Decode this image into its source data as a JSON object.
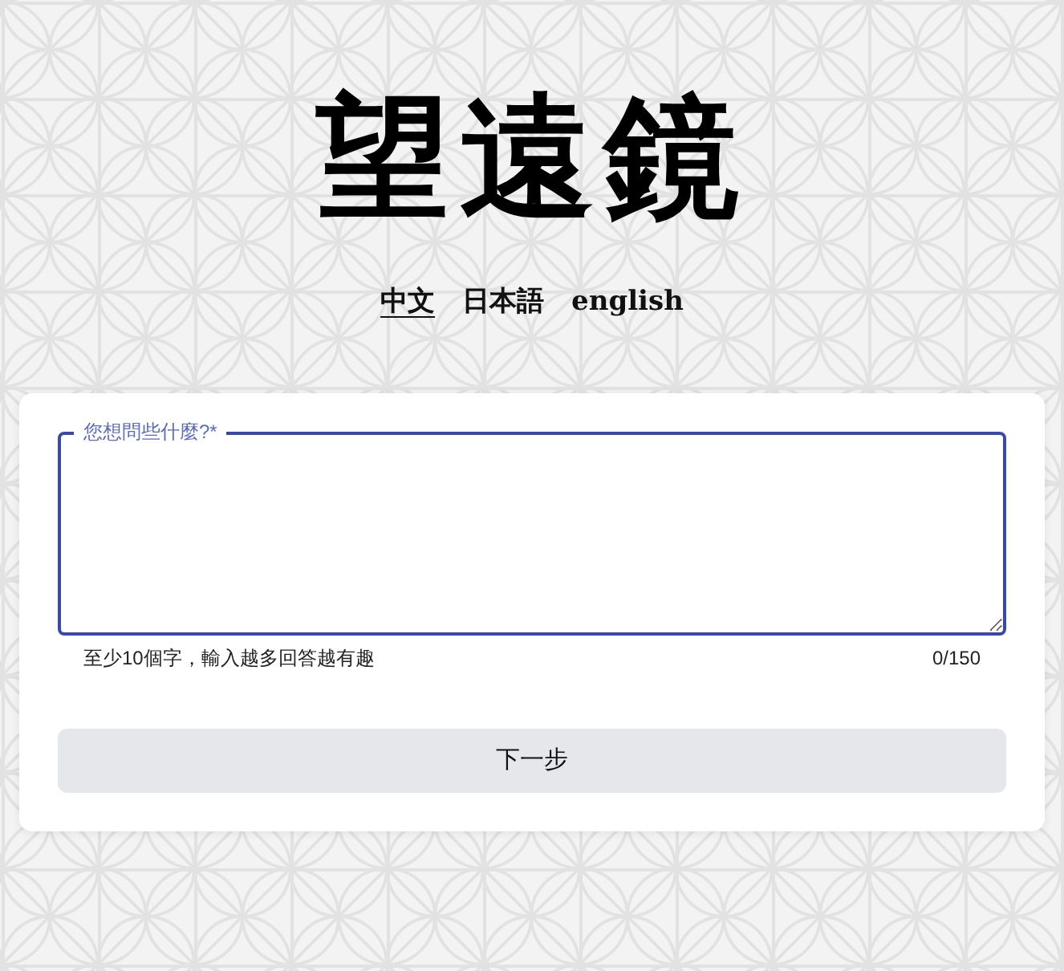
{
  "logo": "望遠鏡",
  "languages": [
    {
      "label": "中文",
      "selected": true
    },
    {
      "label": "日本語",
      "selected": false
    },
    {
      "label": "english",
      "selected": false
    }
  ],
  "question": {
    "label": "您想問些什麼?*",
    "focused": true
  },
  "helper": "至少10個字，輸入越多回答越有趣",
  "counter": "0/150",
  "next_button": "下一步"
}
